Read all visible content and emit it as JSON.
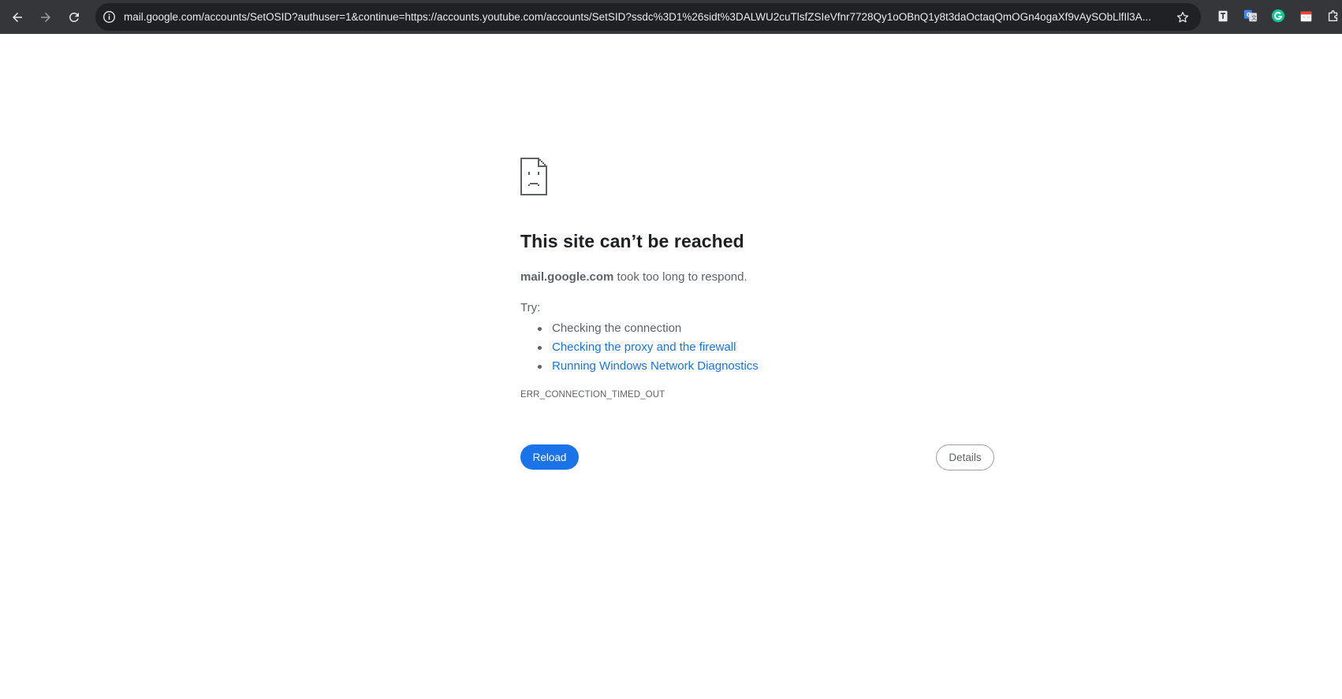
{
  "browser": {
    "url": "mail.google.com/accounts/SetOSID?authuser=1&continue=https://accounts.youtube.com/accounts/SetSID?ssdc%3D1%26sidt%3DALWU2cuTlsfZSIeVfnr7728Qy1oOBnQ1y8t3daOctaqQmOGn4ogaXf9vAySObLlfIl3A...",
    "icons": {
      "back": "back-arrow-icon",
      "forward": "forward-arrow-icon",
      "reload": "reload-icon",
      "site_info": "info-icon",
      "bookmark": "star-icon"
    },
    "extensions": [
      "notes-extension-icon",
      "translate-extension-icon",
      "grammarly-extension-icon",
      "calendar-extension-icon",
      "puzzle-extensions-icon"
    ],
    "colors": {
      "toolbar": "#35363a",
      "omnibox": "#202124",
      "text": "#e8eaed"
    }
  },
  "error": {
    "icon": "sad-page-icon",
    "title": "This site can’t be reached",
    "host": "mail.google.com",
    "summary_rest": " took too long to respond.",
    "try_label": "Try:",
    "suggestions": [
      {
        "text": "Checking the connection",
        "link": false
      },
      {
        "text": "Checking the proxy and the firewall",
        "link": true
      },
      {
        "text": "Running Windows Network Diagnostics",
        "link": true
      }
    ],
    "code": "ERR_CONNECTION_TIMED_OUT",
    "reload_label": "Reload",
    "details_label": "Details",
    "colors": {
      "text": "#5f6368",
      "heading": "#202124",
      "link": "#1a73e8",
      "button": "#1a73e8"
    }
  }
}
